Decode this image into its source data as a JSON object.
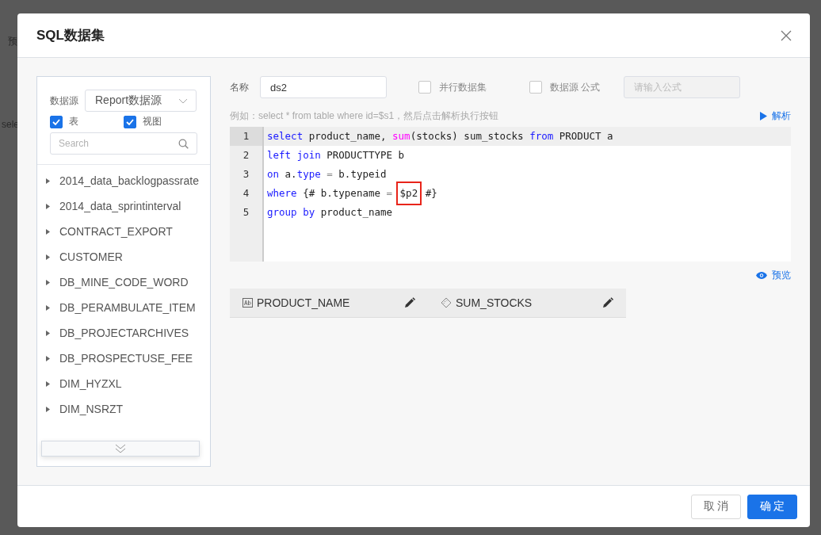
{
  "backdrop": {
    "texts": [
      "预",
      "sele"
    ]
  },
  "dialog": {
    "title": "SQL数据集"
  },
  "source": {
    "label": "数据源",
    "value": "Report数据源",
    "options": [
      {
        "label": "表",
        "checked": true
      },
      {
        "label": "视图",
        "checked": true
      }
    ],
    "search_placeholder": "Search"
  },
  "tables": [
    {
      "label": "2014_data_backlogpassrate",
      "expanded": false
    },
    {
      "label": "2014_data_sprintinterval",
      "expanded": false
    },
    {
      "label": "CONTRACT_EXPORT",
      "expanded": false
    },
    {
      "label": "CUSTOMER",
      "expanded": false
    },
    {
      "label": "DB_MINE_CODE_WORD",
      "expanded": false
    },
    {
      "label": "DB_PERAMBULATE_ITEM",
      "expanded": false
    },
    {
      "label": "DB_PROJECTARCHIVES",
      "expanded": false
    },
    {
      "label": "DB_PROSPECTUSE_FEE",
      "expanded": false
    },
    {
      "label": "DIM_HYZXL",
      "expanded": false
    },
    {
      "label": "DIM_NSRZT",
      "expanded": false
    }
  ],
  "form": {
    "name_label": "名称",
    "name_value": "ds2",
    "parallel": {
      "label": "并行数据集",
      "checked": false
    },
    "formula": {
      "label": "数据源 公式",
      "checked": false
    },
    "formula_placeholder": "请输入公式"
  },
  "hint": "例如：select * from table where id=$s1，然后点击解析执行按钮",
  "parse_link": "解析",
  "code": [
    {
      "number": "1",
      "tokens": [
        {
          "text": "select",
          "kind": "keyword"
        },
        {
          "text": " product_name, ",
          "kind": "plain"
        },
        {
          "text": "sum",
          "kind": "function"
        },
        {
          "text": "(stocks) sum_stocks ",
          "kind": "plain"
        },
        {
          "text": "from",
          "kind": "keyword"
        },
        {
          "text": " PRODUCT a",
          "kind": "plain"
        }
      ]
    },
    {
      "number": "2",
      "tokens": [
        {
          "text": "left join",
          "kind": "keyword"
        },
        {
          "text": " PRODUCTTYPE b",
          "kind": "plain"
        }
      ]
    },
    {
      "number": "3",
      "tokens": [
        {
          "text": "on",
          "kind": "keyword"
        },
        {
          "text": " a.",
          "kind": "plain"
        },
        {
          "text": "type",
          "kind": "keyword"
        },
        {
          "text": " = ",
          "kind": "operator"
        },
        {
          "text": "b.typeid",
          "kind": "plain"
        }
      ]
    },
    {
      "number": "4",
      "tokens": [
        {
          "text": "where",
          "kind": "keyword"
        },
        {
          "text": " {# b.typename ",
          "kind": "plain"
        },
        {
          "text": "= ",
          "kind": "operator"
        },
        {
          "text": "$p2",
          "kind": "marked"
        },
        {
          "text": " #}",
          "kind": "plain"
        }
      ]
    },
    {
      "number": "5",
      "tokens": [
        {
          "text": "group by",
          "kind": "keyword"
        },
        {
          "text": " product_name",
          "kind": "plain"
        }
      ]
    }
  ],
  "preview_link": "预览",
  "columns": [
    {
      "name": "PRODUCT_NAME",
      "kind": "text"
    },
    {
      "name": "SUM_STOCKS",
      "kind": "number"
    }
  ],
  "buttons": [
    {
      "label": "取 消",
      "kind": "secondary"
    },
    {
      "label": "确 定",
      "kind": "primary"
    }
  ]
}
